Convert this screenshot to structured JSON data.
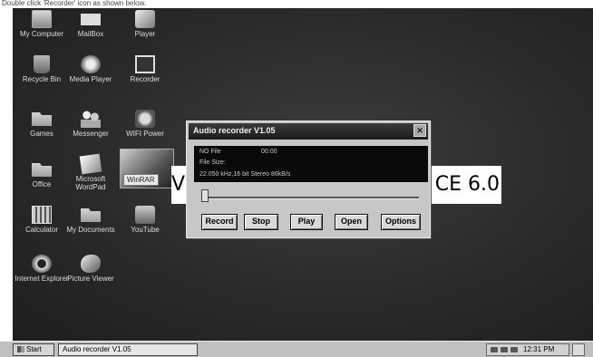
{
  "caption": "Double click 'Recorder' icon as shown below.",
  "desktop": {
    "icons": [
      {
        "label": "My Computer",
        "icon": "computer-icon"
      },
      {
        "label": "MailBox",
        "icon": "mailbox-icon"
      },
      {
        "label": "Player",
        "icon": "player-icon"
      },
      {
        "label": "Recycle Bin",
        "icon": "recycle-bin-icon"
      },
      {
        "label": "Media Player",
        "icon": "media-player-icon"
      },
      {
        "label": "Recorder",
        "icon": "recorder-icon"
      },
      {
        "label": "Games",
        "icon": "games-folder-icon"
      },
      {
        "label": "Messenger",
        "icon": "messenger-icon"
      },
      {
        "label": "WIFI Power",
        "icon": "wifi-power-icon"
      },
      {
        "label": "Office",
        "icon": "office-folder-icon"
      },
      {
        "label": "Microsoft WordPad",
        "icon": "wordpad-icon"
      },
      {
        "label": "WinRAR",
        "icon": "winrar-icon"
      },
      {
        "label": "Calculator",
        "icon": "calculator-icon"
      },
      {
        "label": "My Documents",
        "icon": "documents-folder-icon"
      },
      {
        "label": "YouTube",
        "icon": "youtube-icon"
      },
      {
        "label": "Internet Explorer",
        "icon": "internet-explorer-icon"
      },
      {
        "label": "Picture Viewer",
        "icon": "picture-viewer-icon"
      }
    ],
    "banner": {
      "left_text": "V",
      "right_text": "CE 6.0"
    }
  },
  "recorder_window": {
    "title": "Audio recorder V1.05",
    "close_glyph": "✕",
    "file_label": "NO File",
    "time": "00:00",
    "file_size_label": "File Size:",
    "format": "22.050 kHz,16 bit Stereo 86kB/s",
    "progress_fraction": 0,
    "buttons": [
      "Record",
      "Stop",
      "Play",
      "Open",
      "Options"
    ]
  },
  "taskbar": {
    "start_label": "Start",
    "task_label": "Audio recorder V1.05",
    "clock": "12:31 PM"
  }
}
